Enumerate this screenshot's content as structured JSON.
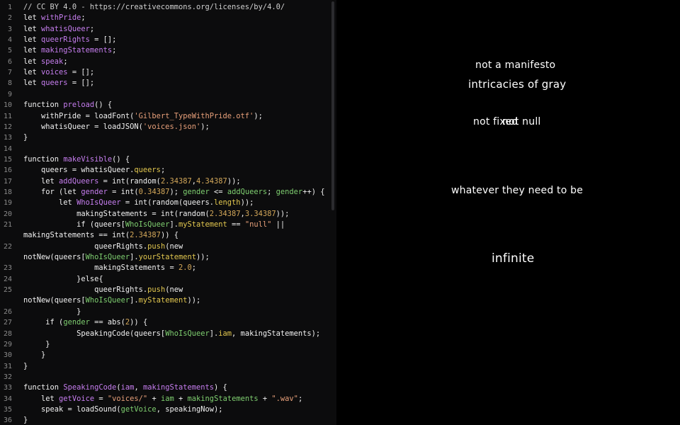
{
  "editor": {
    "lines": [
      {
        "n": "1",
        "t": [
          [
            "c",
            "// CC BY 4.0 - https://creativecommons.org/licenses/by/4.0/"
          ]
        ]
      },
      {
        "n": "2",
        "t": [
          [
            "k",
            "let "
          ],
          [
            "v",
            "withPride"
          ],
          [
            "k",
            ";"
          ]
        ]
      },
      {
        "n": "3",
        "t": [
          [
            "k",
            "let "
          ],
          [
            "v",
            "whatisQueer"
          ],
          [
            "k",
            ";"
          ]
        ]
      },
      {
        "n": "4",
        "t": [
          [
            "k",
            "let "
          ],
          [
            "v",
            "queerRights"
          ],
          [
            "k",
            " = [];"
          ]
        ]
      },
      {
        "n": "5",
        "t": [
          [
            "k",
            "let "
          ],
          [
            "v",
            "makingStatements"
          ],
          [
            "k",
            ";"
          ]
        ]
      },
      {
        "n": "6",
        "t": [
          [
            "k",
            "let "
          ],
          [
            "v",
            "speak"
          ],
          [
            "k",
            ";"
          ]
        ]
      },
      {
        "n": "7",
        "t": [
          [
            "k",
            "let "
          ],
          [
            "v",
            "voices"
          ],
          [
            "k",
            " = [];"
          ]
        ]
      },
      {
        "n": "8",
        "t": [
          [
            "k",
            "let "
          ],
          [
            "v",
            "queers"
          ],
          [
            "k",
            " = [];"
          ]
        ]
      },
      {
        "n": "9",
        "t": []
      },
      {
        "n": "10",
        "t": [
          [
            "k",
            "function "
          ],
          [
            "v",
            "preload"
          ],
          [
            "k",
            "() {"
          ]
        ]
      },
      {
        "n": "11",
        "t": [
          [
            "k",
            "    withPride = loadFont("
          ],
          [
            "s",
            "'Gilbert_TypeWithPride.otf'"
          ],
          [
            "k",
            ");"
          ]
        ]
      },
      {
        "n": "12",
        "t": [
          [
            "k",
            "    whatisQueer = loadJSON("
          ],
          [
            "s",
            "'voices.json'"
          ],
          [
            "k",
            ");"
          ]
        ]
      },
      {
        "n": "13",
        "t": [
          [
            "k",
            "}"
          ]
        ]
      },
      {
        "n": "14",
        "t": []
      },
      {
        "n": "15",
        "t": [
          [
            "k",
            "function "
          ],
          [
            "v",
            "makeVisible"
          ],
          [
            "k",
            "() {"
          ]
        ]
      },
      {
        "n": "16",
        "t": [
          [
            "k",
            "    queers = whatisQueer."
          ],
          [
            "y",
            "queers"
          ],
          [
            "k",
            ";"
          ]
        ]
      },
      {
        "n": "17",
        "t": [
          [
            "k",
            "    let "
          ],
          [
            "v",
            "addQueers"
          ],
          [
            "k",
            " = int(random("
          ],
          [
            "n",
            "2.34387"
          ],
          [
            "k",
            ","
          ],
          [
            "n",
            "4.34387"
          ],
          [
            "k",
            "));"
          ]
        ]
      },
      {
        "n": "18",
        "t": [
          [
            "k",
            "    for (let "
          ],
          [
            "v",
            "gender"
          ],
          [
            "k",
            " = int("
          ],
          [
            "n",
            "0.34387"
          ],
          [
            "k",
            "); "
          ],
          [
            "g",
            "gender"
          ],
          [
            "k",
            " <= "
          ],
          [
            "g",
            "addQueers"
          ],
          [
            "k",
            "; "
          ],
          [
            "g",
            "gender"
          ],
          [
            "k",
            "++) {"
          ]
        ]
      },
      {
        "n": "19",
        "t": [
          [
            "k",
            "        let "
          ],
          [
            "v",
            "WhoIsQueer"
          ],
          [
            "k",
            " = int(random(queers."
          ],
          [
            "y",
            "length"
          ],
          [
            "k",
            "));"
          ]
        ]
      },
      {
        "n": "20",
        "t": [
          [
            "k",
            "            makingStatements = int(random("
          ],
          [
            "n",
            "2.34387"
          ],
          [
            "k",
            ","
          ],
          [
            "n",
            "3.34387"
          ],
          [
            "k",
            "));"
          ]
        ]
      },
      {
        "n": "21",
        "t": [
          [
            "k",
            "            if (queers["
          ],
          [
            "g",
            "WhoIsQueer"
          ],
          [
            "k",
            "]."
          ],
          [
            "y",
            "myStatement"
          ],
          [
            "k",
            " == "
          ],
          [
            "s",
            "\"null\""
          ],
          [
            "k",
            " ||"
          ]
        ]
      },
      {
        "n": "",
        "t": [
          [
            "k",
            "makingStatements == int("
          ],
          [
            "n",
            "2.34387"
          ],
          [
            "k",
            ")) {"
          ]
        ]
      },
      {
        "n": "22",
        "t": [
          [
            "k",
            "                queerRights."
          ],
          [
            "y",
            "push"
          ],
          [
            "k",
            "(new"
          ]
        ]
      },
      {
        "n": "",
        "t": [
          [
            "k",
            "notNew(queers["
          ],
          [
            "g",
            "WhoIsQueer"
          ],
          [
            "k",
            "]."
          ],
          [
            "y",
            "yourStatement"
          ],
          [
            "k",
            "));"
          ]
        ]
      },
      {
        "n": "23",
        "t": [
          [
            "k",
            "                makingStatements = "
          ],
          [
            "n",
            "2.0"
          ],
          [
            "k",
            ";"
          ]
        ]
      },
      {
        "n": "24",
        "t": [
          [
            "k",
            "            }else{"
          ]
        ]
      },
      {
        "n": "25",
        "t": [
          [
            "k",
            "                queerRights."
          ],
          [
            "y",
            "push"
          ],
          [
            "k",
            "(new"
          ]
        ]
      },
      {
        "n": "",
        "t": [
          [
            "k",
            "notNew(queers["
          ],
          [
            "g",
            "WhoIsQueer"
          ],
          [
            "k",
            "]."
          ],
          [
            "y",
            "myStatement"
          ],
          [
            "k",
            "));"
          ]
        ]
      },
      {
        "n": "26",
        "t": [
          [
            "k",
            "            }"
          ]
        ]
      },
      {
        "n": "27",
        "t": [
          [
            "k",
            "     if ("
          ],
          [
            "g",
            "gender"
          ],
          [
            "k",
            " == abs("
          ],
          [
            "n",
            "2"
          ],
          [
            "k",
            ")) {"
          ]
        ]
      },
      {
        "n": "28",
        "t": [
          [
            "k",
            "            SpeakingCode(queers["
          ],
          [
            "g",
            "WhoIsQueer"
          ],
          [
            "k",
            "]."
          ],
          [
            "y",
            "iam"
          ],
          [
            "k",
            ", makingStatements);"
          ]
        ]
      },
      {
        "n": "29",
        "t": [
          [
            "k",
            "     }"
          ]
        ]
      },
      {
        "n": "30",
        "t": [
          [
            "k",
            "    }"
          ]
        ]
      },
      {
        "n": "31",
        "t": [
          [
            "k",
            "}"
          ]
        ]
      },
      {
        "n": "32",
        "t": []
      },
      {
        "n": "33",
        "t": [
          [
            "k",
            "function "
          ],
          [
            "v",
            "SpeakingCode"
          ],
          [
            "k",
            "("
          ],
          [
            "v",
            "iam"
          ],
          [
            "k",
            ", "
          ],
          [
            "v",
            "makingStatements"
          ],
          [
            "k",
            ") {"
          ]
        ]
      },
      {
        "n": "34",
        "t": [
          [
            "k",
            "    let "
          ],
          [
            "v",
            "getVoice"
          ],
          [
            "k",
            " = "
          ],
          [
            "s",
            "\"voices/\""
          ],
          [
            "k",
            " + "
          ],
          [
            "g",
            "iam"
          ],
          [
            "k",
            " + "
          ],
          [
            "g",
            "makingStatements"
          ],
          [
            "k",
            " + "
          ],
          [
            "s",
            "\".wav\""
          ],
          [
            "k",
            ";"
          ]
        ]
      },
      {
        "n": "35",
        "t": [
          [
            "k",
            "    speak = loadSound("
          ],
          [
            "g",
            "getVoice"
          ],
          [
            "k",
            ", speakingNow);"
          ]
        ]
      },
      {
        "n": "36",
        "t": [
          [
            "k",
            "}"
          ]
        ]
      }
    ]
  },
  "canvas": {
    "phrases": [
      {
        "text": "not a manifesto",
        "id": "phrase-not-a-manifesto"
      },
      {
        "text": "intricacies of gray",
        "id": "phrase-intricacies-of-gray"
      },
      {
        "text": "not fixed",
        "id": "phrase-not-fixed"
      },
      {
        "text": "not null",
        "id": "phrase-not-null"
      },
      {
        "text": "whatever they need to be",
        "id": "phrase-whatever-they-need-to-be"
      },
      {
        "text": "infinite",
        "id": "phrase-infinite"
      }
    ]
  }
}
